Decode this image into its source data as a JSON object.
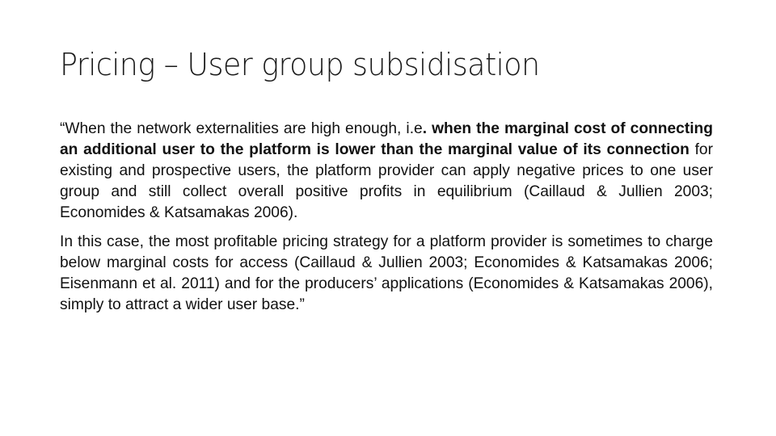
{
  "slide": {
    "title": "Pricing – User group subsidisation",
    "paragraphs": [
      {
        "segments": [
          {
            "text": "“When the network externalities are high enough, i.e",
            "bold": false
          },
          {
            "text": ". when the marginal cost of connecting an additional user to the platform is lower than the marginal value of its connection",
            "bold": true
          },
          {
            "text": " for existing and prospective users,  the platform provider can apply negative prices to one user group and still collect overall positive profits in equilibrium (Caillaud & Jullien 2003; Economides & Katsamakas 2006).",
            "bold": false
          }
        ]
      },
      {
        "segments": [
          {
            "text": "In this case, the most profitable pricing strategy for a platform provider is sometimes to charge below marginal costs for access (Caillaud & Jullien 2003; Economides & Katsamakas 2006; Eisenmann et al. 2011) and for the producers’ applications  (Economides & Katsamakas 2006), simply to attract a wider user base.”",
            "bold": false
          }
        ]
      }
    ]
  }
}
